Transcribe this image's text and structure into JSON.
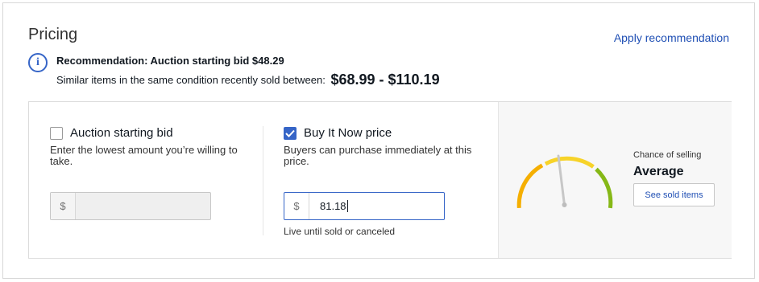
{
  "section": {
    "title": "Pricing",
    "apply_link": "Apply recommendation"
  },
  "recommendation": {
    "icon": "info-icon",
    "headline": "Recommendation: Auction starting bid $48.29",
    "similar_text": "Similar items in the same condition recently sold between:",
    "range": "$68.99 - $110.19"
  },
  "auction": {
    "label": "Auction starting bid",
    "checked": false,
    "help": "Enter the lowest amount you’re willing to take.",
    "currency_symbol": "$",
    "value": ""
  },
  "buy_it_now": {
    "label": "Buy It Now price",
    "checked": true,
    "help": "Buyers can purchase immediately at this price.",
    "currency_symbol": "$",
    "value": "81.18",
    "duration_note": "Live until sold or canceled"
  },
  "chance_of_selling": {
    "label": "Chance of selling",
    "value": "Average",
    "button_label": "See sold items",
    "colors": {
      "low": "#f5af02",
      "mid": "#f7d329",
      "high": "#86b817",
      "needle": "#c7c7c7"
    }
  },
  "theme": {
    "accent": "#3665c7",
    "link": "#1f4fb4"
  }
}
